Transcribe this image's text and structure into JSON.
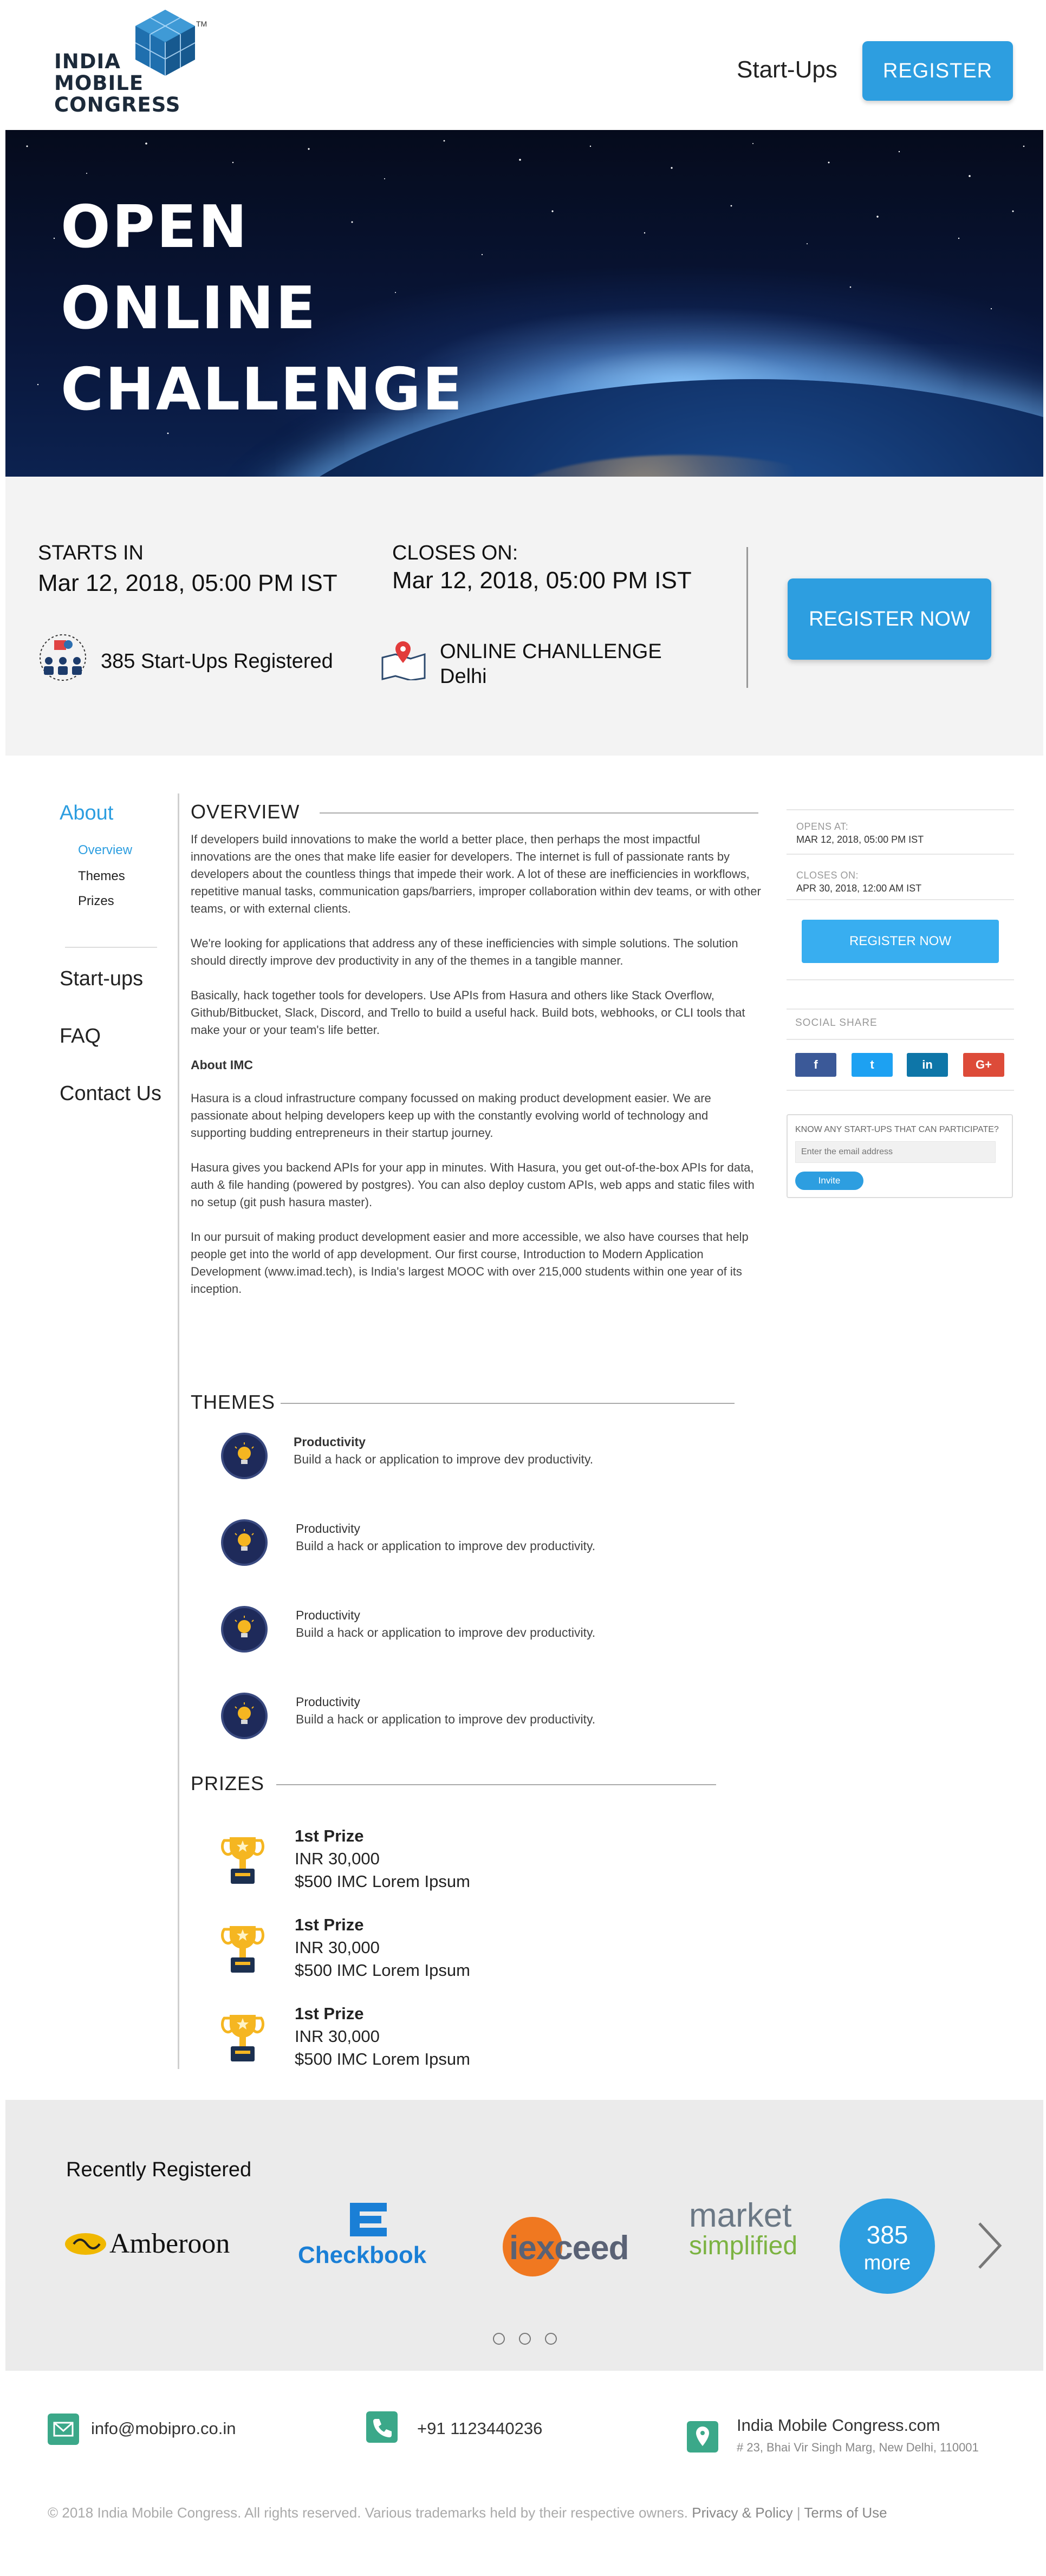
{
  "header": {
    "logo_text": [
      "INDIA",
      "MOBILE",
      "CONGRESS"
    ],
    "logo_tm": "TM",
    "nav_startups": "Start-Ups",
    "register_label": "REGISTER"
  },
  "hero": {
    "title_lines": [
      "OPEN",
      "ONLINE",
      "CHALLENGE"
    ]
  },
  "event": {
    "starts_label": "STARTS IN",
    "starts_value": "Mar 12, 2018, 05:00 PM IST",
    "closes_label": "CLOSES ON:",
    "closes_value": "Mar 12, 2018, 05:00 PM IST",
    "registered_text": "385 Start-Ups Registered",
    "location_line1": "ONLINE CHANLLENGE",
    "location_line2": "Delhi",
    "register_now_label": "REGISTER NOW"
  },
  "leftnav": {
    "about": "About",
    "sub_items": [
      "Overview",
      "Themes",
      "Prizes"
    ],
    "startups": "Start-ups",
    "faq": "FAQ",
    "contact": "Contact Us"
  },
  "overview": {
    "title": "OVERVIEW",
    "paragraphs": [
      "If developers build innovations to make the world a better place, then perhaps the most impactful innovations are the ones that make life easier for developers. The internet is full of passionate rants by developers about the countless things that impede their work. A lot of these are inefficiencies in workflows, repetitive manual tasks, communication gaps/barriers, improper collaboration within dev teams, or with other teams, or with external clients.",
      "We're looking for applications that address any of these inefficiencies with simple solutions. The solution should directly improve dev productivity in any of the themes in a tangible manner.",
      "Basically, hack together tools for developers. Use APIs from Hasura and others like Stack Overflow, Github/Bitbucket, Slack, Discord, and Trello to build a useful hack. Build bots, webhooks, or CLI tools that make your or your team's life better."
    ],
    "about_imc_title": "About IMC",
    "about_paragraphs": [
      "Hasura is a cloud infrastructure company focussed on making product development easier. We are passionate about helping developers keep up with the constantly evolving world of technology and supporting budding entrepreneurs in their startup journey.",
      "Hasura gives you backend APIs for your app in minutes. With Hasura, you get out-of-the-box APIs for data, auth & file handing (powered by postgres). You can also deploy custom APIs, web apps and static files with no setup (git push hasura master).",
      "In our pursuit of making product development easier and more accessible, we also have courses that help people get into the world of app development. Our first course, Introduction to Modern Application Development (www.imad.tech), is India's largest MOOC with over 215,000 students within one year of its inception."
    ]
  },
  "themes": {
    "title": "THEMES",
    "items": [
      {
        "name": "Productivity",
        "desc": "Build a hack or application to improve dev productivity."
      },
      {
        "name": "Productivity",
        "desc": "Build a hack or application to improve dev productivity."
      },
      {
        "name": "Productivity",
        "desc": "Build a hack or application to improve dev productivity."
      },
      {
        "name": "Productivity",
        "desc": "Build a hack or application to improve dev productivity."
      }
    ]
  },
  "prizes": {
    "title": "PRIZES",
    "items": [
      {
        "rank": "1st Prize",
        "amount": "INR 30,000",
        "extra": "$500 IMC Lorem Ipsum"
      },
      {
        "rank": "1st Prize",
        "amount": "INR 30,000",
        "extra": "$500 IMC Lorem Ipsum"
      },
      {
        "rank": "1st Prize",
        "amount": "INR 30,000",
        "extra": "$500 IMC Lorem Ipsum"
      }
    ]
  },
  "sidebar": {
    "opens_label": "OPENS AT:",
    "opens_value": "MAR 12, 2018, 05:00 PM IST",
    "closes_label": "CLOSES ON:",
    "closes_value": "APR 30, 2018, 12:00 AM IST",
    "register_label": "REGISTER NOW",
    "social_title": "SOCIAL SHARE",
    "social": [
      {
        "glyph": "f",
        "color": "#3b5998"
      },
      {
        "glyph": "t",
        "color": "#1da1f2"
      },
      {
        "glyph": "in",
        "color": "#0e76a8"
      },
      {
        "glyph": "G+",
        "color": "#dd4b39"
      }
    ],
    "invite_label": "KNOW ANY START-UPS THAT CAN PARTICIPATE?",
    "invite_placeholder": "Enter the email address",
    "invite_button": "Invite"
  },
  "recent": {
    "title": "Recently Registered",
    "logos": [
      "Amberoon",
      "Checkbook",
      "iexceed",
      "market",
      "simplified"
    ],
    "more_count": "385",
    "more_label": "more"
  },
  "footer": {
    "email": "info@mobipro.co.in",
    "phone": "+91 1123440236",
    "org": "India Mobile Congress.com",
    "address": "# 23, Bhai Vir Singh Marg, New Delhi, 110001",
    "copyright": "© 2018 India Mobile Congress. All rights reserved. Various trademarks held by their respective owners.",
    "privacy": "Privacy & Policy",
    "separator": "|",
    "terms": "Terms of Use"
  }
}
